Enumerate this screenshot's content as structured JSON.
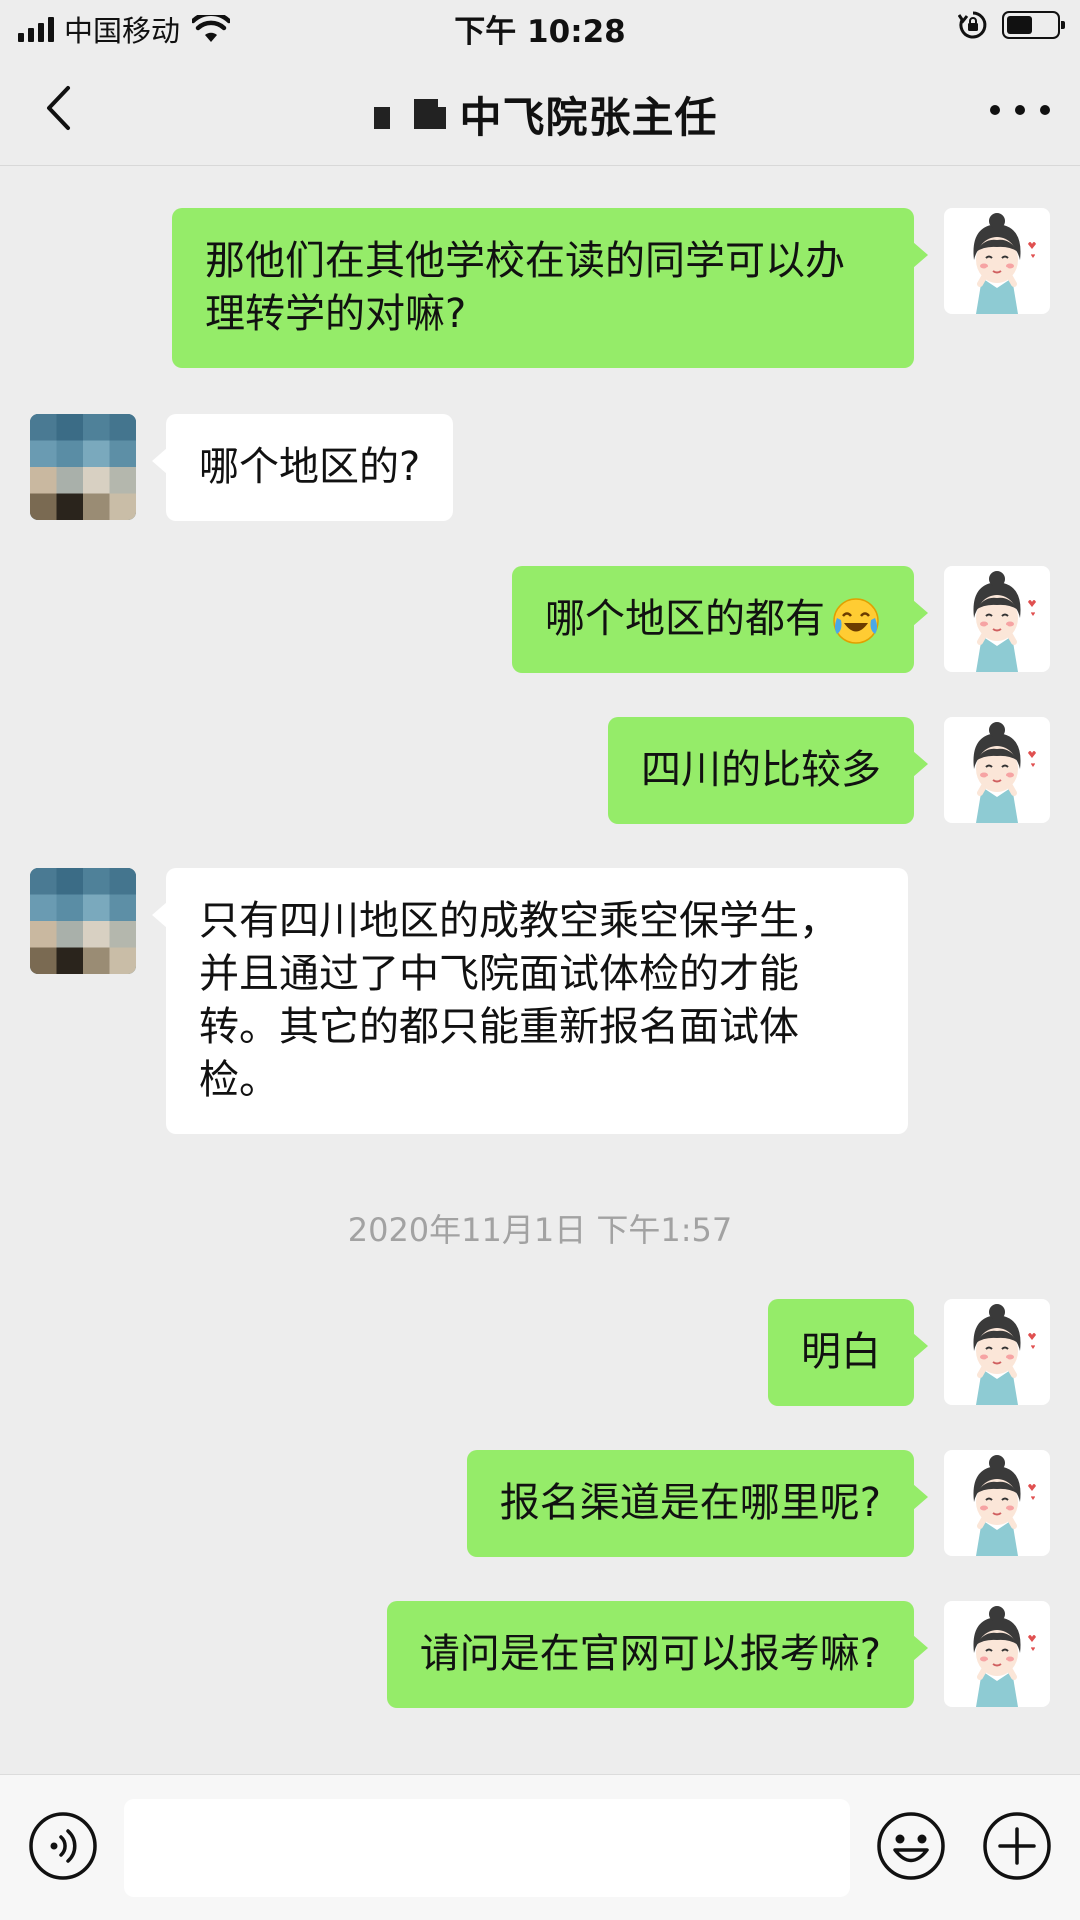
{
  "status_bar": {
    "carrier": "中国移动",
    "time": "下午 10:28",
    "battery_level": 0.55
  },
  "header": {
    "title": "中飞院张主任"
  },
  "messages": [
    {
      "side": "me",
      "text": "那他们在其他学校在读的同学可以办理转学的对嘛?"
    },
    {
      "side": "them",
      "text": "哪个地区的?"
    },
    {
      "side": "me",
      "text": "哪个地区的都有",
      "emoji": "face-with-tears-of-joy"
    },
    {
      "side": "me",
      "text": "四川的比较多"
    },
    {
      "side": "them",
      "text": "只有四川地区的成教空乘空保学生，并且通过了中飞院面试体检的才能转。其它的都只能重新报名面试体检。"
    },
    {
      "side": "me",
      "text": "明白"
    },
    {
      "side": "me",
      "text": "报名渠道是在哪里呢?"
    },
    {
      "side": "me",
      "text": "请问是在官网可以报考嘛?"
    }
  ],
  "timestamp": "2020年11月1日 下午1:57",
  "input_bar": {
    "placeholder": "",
    "icons": [
      "voice-icon",
      "emoji-icon",
      "plus-icon"
    ]
  },
  "colors": {
    "background": "#ededed",
    "my_bubble": "#95ec69",
    "their_bubble": "#ffffff",
    "timestamp_text": "#a2a2a2"
  }
}
